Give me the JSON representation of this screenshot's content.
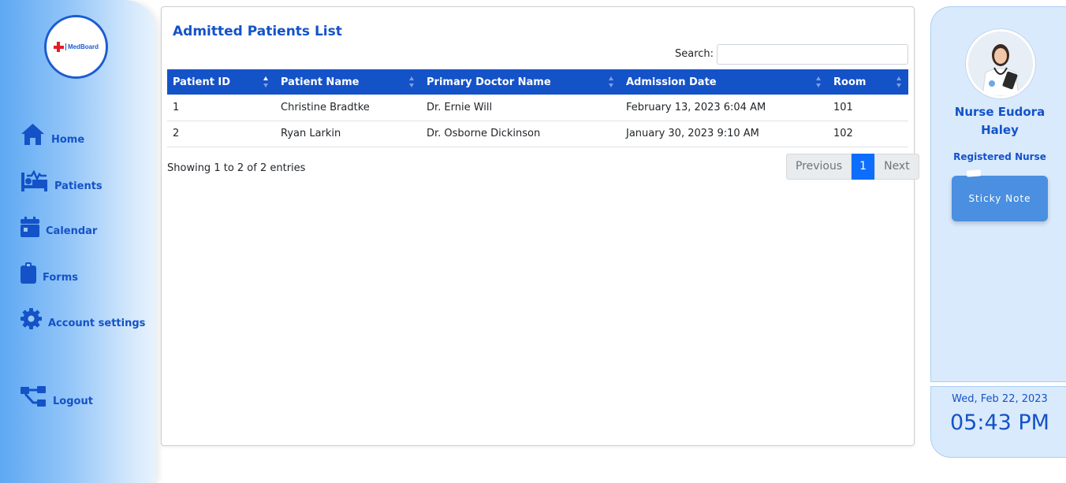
{
  "logo": {
    "text": "MedBoard"
  },
  "sidebar": {
    "items": [
      {
        "label": "Home",
        "icon": "home-icon"
      },
      {
        "label": "Patients",
        "icon": "bed-pulse-icon"
      },
      {
        "label": "Calendar",
        "icon": "calendar-icon"
      },
      {
        "label": "Forms",
        "icon": "clipboard-icon"
      },
      {
        "label": "Account settings",
        "icon": "gear-icon"
      },
      {
        "label": "Logout",
        "icon": "sitemap-icon"
      }
    ]
  },
  "main": {
    "title": "Admitted Patients List",
    "search_label": "Search:",
    "search_value": "",
    "columns": [
      "Patient ID",
      "Patient Name",
      "Primary Doctor Name",
      "Admission Date",
      "Room"
    ],
    "rows": [
      [
        "1",
        "Christine Bradtke",
        "Dr. Ernie Will",
        "February 13, 2023 6:04 AM",
        "101"
      ],
      [
        "2",
        "Ryan Larkin",
        "Dr. Osborne Dickinson",
        "January 30, 2023 9:10 AM",
        "102"
      ]
    ],
    "info": "Showing 1 to 2 of 2 entries",
    "pager": {
      "previous": "Previous",
      "current": "1",
      "next": "Next"
    }
  },
  "profile": {
    "name": "Nurse Eudora Haley",
    "role": "Registered Nurse",
    "sticky_label": "Sticky Note"
  },
  "clock": {
    "date": "Wed, Feb 22, 2023",
    "time": "05:43 PM"
  },
  "colors": {
    "primary": "#1452c8",
    "pager_active": "#0d6efd",
    "panel_bg": "#d9eafc"
  }
}
